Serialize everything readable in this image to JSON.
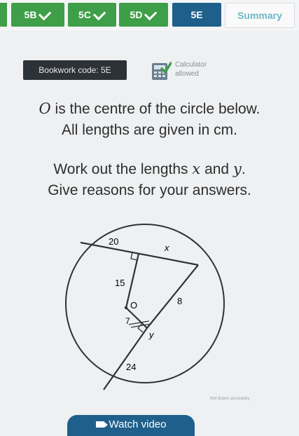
{
  "tabs": [
    {
      "label": "5B",
      "status": "complete"
    },
    {
      "label": "5C",
      "status": "complete"
    },
    {
      "label": "5D",
      "status": "complete"
    },
    {
      "label": "5E",
      "status": "current"
    },
    {
      "label": "Summary",
      "status": "normal"
    }
  ],
  "bookwork": {
    "label": "Bookwork code: 5E"
  },
  "calculator": {
    "line1": "Calculator",
    "line2": "allowed"
  },
  "question": {
    "line1_var": "O",
    "line1_text": " is the centre of the circle below.",
    "line2": "All lengths are given in cm.",
    "line3_pre": "Work out the lengths ",
    "line3_x": "x",
    "line3_mid": " and ",
    "line3_y": "y",
    "line3_post": ".",
    "line4": "Give reasons for your answers."
  },
  "diagram": {
    "labels": {
      "top_chord": "20",
      "x_label": "x",
      "left_segment": "15",
      "right_segment": "8",
      "center": "O",
      "center_seg": "7",
      "y_label": "y",
      "bottom_segment": "24"
    },
    "credit": "Not drawn accurately"
  },
  "video": {
    "label": "Watch video"
  },
  "colors": {
    "complete": "#3f9e48",
    "current": "#1f5f8b",
    "summary_text": "#6bb8c8",
    "badge": "#2d3238"
  }
}
